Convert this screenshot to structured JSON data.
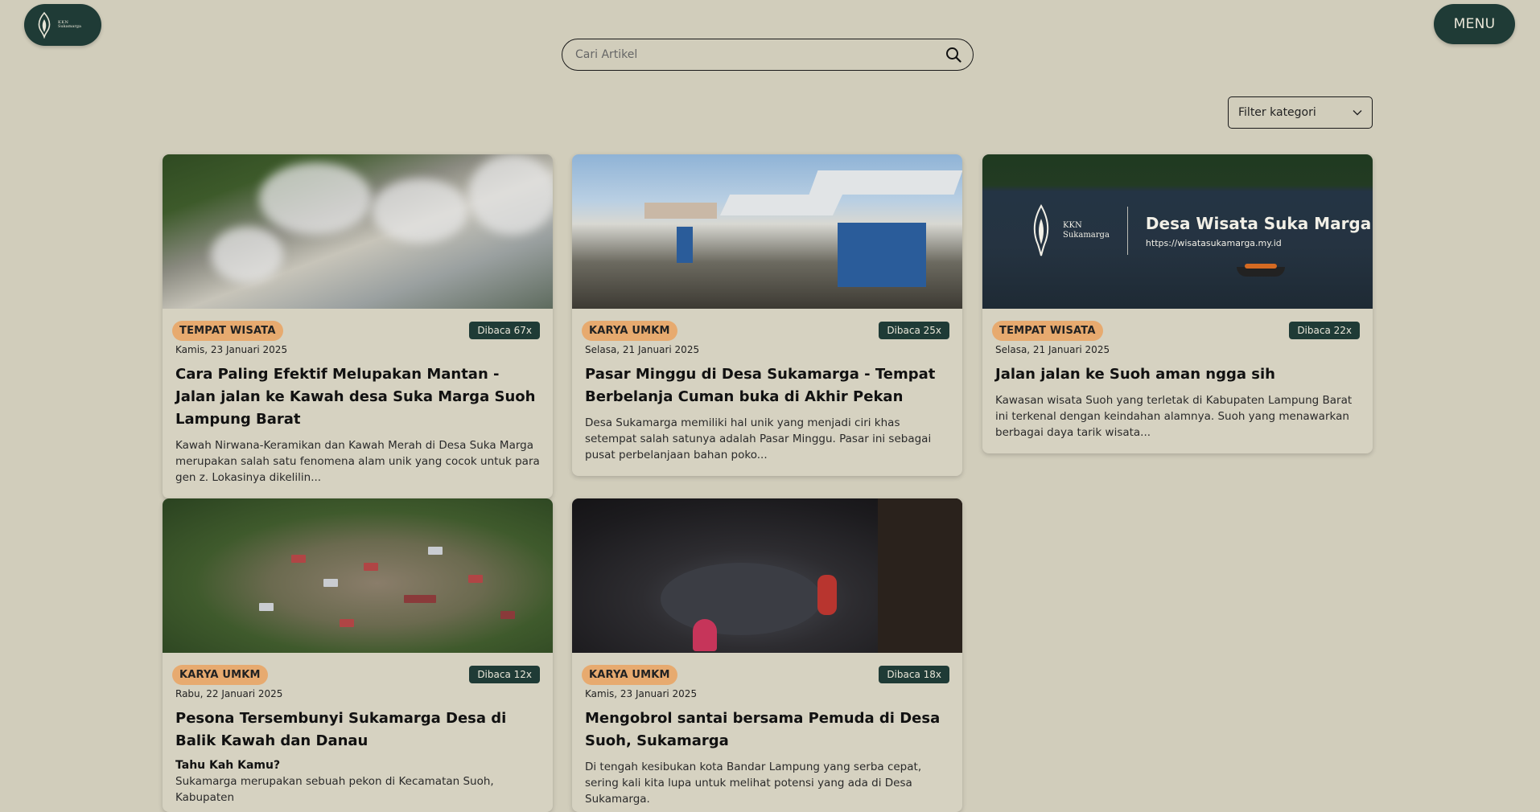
{
  "brand": {
    "logo_line1": "KKN",
    "logo_line2": "Sukamarga"
  },
  "header": {
    "menu_label": "MENU"
  },
  "search": {
    "placeholder": "Cari Artikel"
  },
  "filter": {
    "label": "Filter kategori"
  },
  "banner": {
    "logo_line1": "KKN",
    "logo_line2": "Sukamarga",
    "title": "Desa Wisata Suka Marga",
    "url": "https://wisatasukamarga.my.id"
  },
  "cards": [
    {
      "tag": "TEMPAT WISATA",
      "reads": "Dibaca 67x",
      "date": "Kamis, 23 Januari 2025",
      "title": "Cara Paling Efektif Melupakan Mantan - Jalan jalan ke Kawah desa Suka Marga Suoh Lampung Barat",
      "excerpt": "Kawah Nirwana-Keramikan dan Kawah Merah di Desa Suka Marga merupakan salah satu fenomena alam unik yang cocok untuk para gen z. Lokasinya dikelilin..."
    },
    {
      "tag": "KARYA UMKM",
      "reads": "Dibaca 25x",
      "date": "Selasa, 21 Januari 2025",
      "title": "Pasar Minggu di Desa Sukamarga - Tempat Berbelanja Cuman buka di Akhir Pekan",
      "excerpt": "Desa Sukamarga memiliki hal unik yang menjadi ciri khas setempat salah satunya adalah Pasar Minggu. Pasar ini sebagai pusat perbelanjaan bahan poko..."
    },
    {
      "tag": "TEMPAT WISATA",
      "reads": "Dibaca 22x",
      "date": "Selasa, 21 Januari 2025",
      "title": "Jalan jalan ke Suoh aman ngga sih",
      "excerpt": "Kawasan wisata Suoh yang terletak di Kabupaten Lampung Barat ini terkenal dengan keindahan alamnya. Suoh yang menawarkan berbagai daya tarik wisata..."
    },
    {
      "tag": "KARYA UMKM",
      "reads": "Dibaca 12x",
      "date": "Rabu, 22 Januari 2025",
      "title": "Pesona Tersembunyi Sukamarga Desa di Balik Kawah dan Danau",
      "subhead": "Tahu Kah Kamu?",
      "excerpt": "Sukamarga merupakan sebuah pekon di Kecamatan Suoh, Kabupaten"
    },
    {
      "tag": "KARYA UMKM",
      "reads": "Dibaca 18x",
      "date": "Kamis, 23 Januari 2025",
      "title": "Mengobrol santai bersama Pemuda di Desa Suoh, Sukamarga",
      "excerpt": "Di tengah kesibukan kota Bandar Lampung yang serba cepat, sering kali kita lupa untuk melihat potensi yang ada di Desa Sukamarga."
    }
  ]
}
